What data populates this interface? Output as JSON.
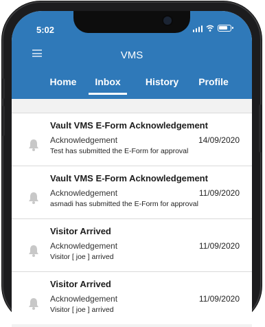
{
  "status_bar": {
    "time": "5:02"
  },
  "header": {
    "title": "VMS",
    "menu_icon": "menu-icon"
  },
  "tabs": [
    {
      "label": "Home",
      "active": false
    },
    {
      "label": "Inbox",
      "active": true
    },
    {
      "label": "History",
      "active": false
    },
    {
      "label": "Profile",
      "active": false
    }
  ],
  "notifications": [
    {
      "icon": "bell-icon",
      "title": "Vault VMS E-Form Acknowledgement",
      "type": "Acknowledgement",
      "date": "14/09/2020",
      "message": "Test has submitted the E-Form for approval"
    },
    {
      "icon": "bell-icon",
      "title": "Vault VMS E-Form Acknowledgement",
      "type": "Acknowledgement",
      "date": "11/09/2020",
      "message": "asmadi has submitted the E-Form for approval"
    },
    {
      "icon": "bell-icon",
      "title": "Visitor Arrived",
      "type": "Acknowledgement",
      "date": "11/09/2020",
      "message": "Visitor [ joe ] arrived"
    },
    {
      "icon": "bell-icon",
      "title": "Visitor Arrived",
      "type": "Acknowledgement",
      "date": "11/09/2020",
      "message": "Visitor [ joe ] arrived"
    }
  ],
  "colors": {
    "header": "#2f79b9",
    "background": "#f2f2f2",
    "bell": "#c8c8c8"
  }
}
